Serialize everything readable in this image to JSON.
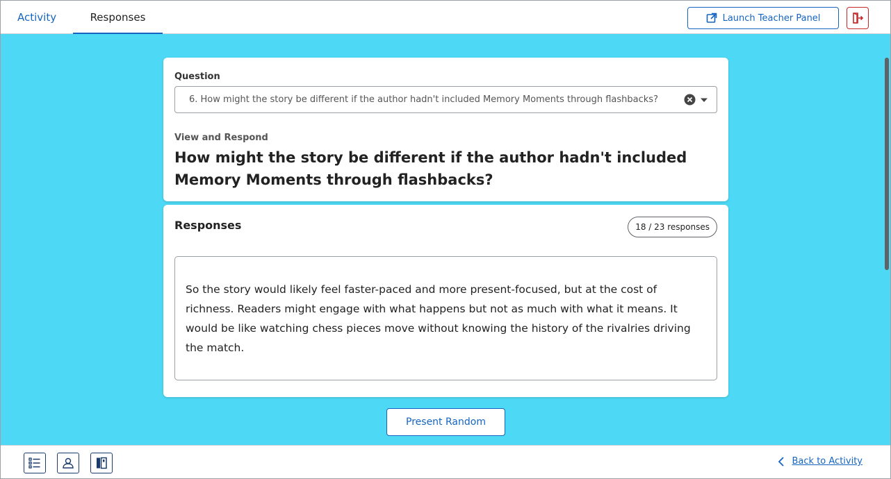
{
  "header": {
    "tabs": [
      {
        "label": "Activity",
        "active": false
      },
      {
        "label": "Responses",
        "active": true
      }
    ],
    "launch_label": "Launch Teacher Panel",
    "launch_icon": "external-link-icon",
    "exit_icon": "exit-icon"
  },
  "question_card": {
    "label": "Question",
    "selected_question": "6. How might the story be different if the author hadn't included Memory Moments through flashbacks?",
    "view_label": "View and Respond",
    "title": "How might the story be different if the author hadn't included Memory Moments through flashbacks?"
  },
  "responses_card": {
    "title": "Responses",
    "count": "18 / 23 responses",
    "response_text": "So the story would likely feel faster-paced and more present-focused, but at the cost of richness. Readers might engage with what happens but not as much with what it means. It would be like watching chess pieces move without knowing the history of the rivalries driving the match."
  },
  "actions": {
    "present_random": "Present Random"
  },
  "footer": {
    "tools": [
      "list-icon",
      "person-icon",
      "bookmark-icon"
    ],
    "back_label": "Back to Activity"
  },
  "colors": {
    "accent": "#1565c0",
    "background": "#4dd9f5",
    "exit": "#c62828"
  }
}
